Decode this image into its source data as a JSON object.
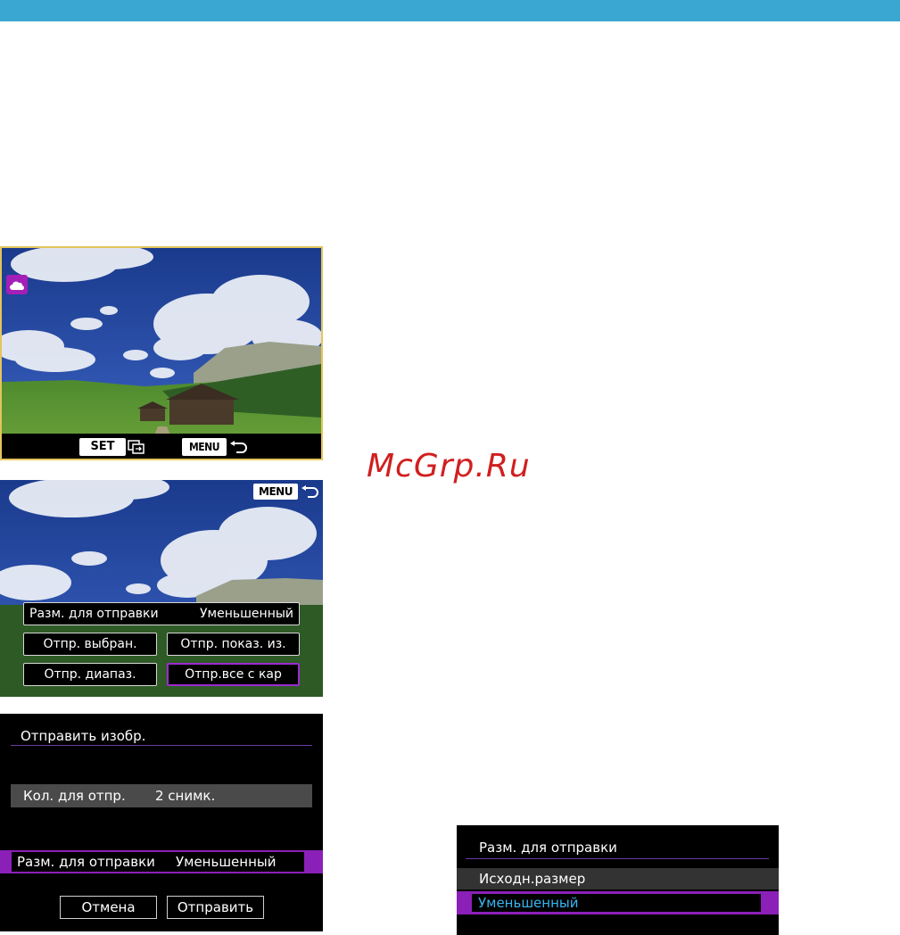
{
  "header": {
    "bar_color": "#3aa6d2"
  },
  "screen1": {
    "set_key": "SET",
    "menu_key": "MENU",
    "icons": [
      "cloud-icon",
      "transfer-icon",
      "back-arrow-icon"
    ]
  },
  "screen2": {
    "menu_key": "MENU",
    "size_label": "Разм. для отправки",
    "size_value": "Уменьшенный",
    "send_selected": "Отпр. выбран.",
    "send_shown": "Отпр. показ. из.",
    "send_range": "Отпр. диапаз.",
    "send_all": "Отпр.все с кар"
  },
  "screen3": {
    "title": "Отправить изобр.",
    "count_label": "Кол. для отпр.",
    "count_value": "2 снимк.",
    "size_label": "Разм. для отправки",
    "size_value": "Уменьшенный",
    "cancel": "Отмена",
    "send": "Отправить"
  },
  "screen4": {
    "title": "Разм. для отправки",
    "options": [
      "Исходн.размер",
      "Уменьшенный"
    ],
    "selected": "Уменьшенный"
  },
  "watermark": "McGrp.Ru",
  "colors": {
    "accent_purple": "#8b20b8",
    "selected_text": "#38b5f0",
    "frame_gold": "#e3c55a"
  }
}
